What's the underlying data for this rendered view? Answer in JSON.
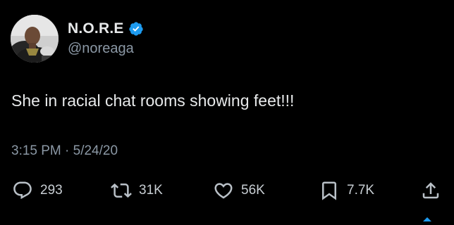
{
  "tweet": {
    "author": {
      "display_name": "N.O.R.E",
      "handle": "@noreaga",
      "verified": true
    },
    "text": "She in racial chat rooms showing feet!!!",
    "time": "3:15 PM",
    "separator": "·",
    "date": "5/24/20",
    "meta_line": "3:15 PM · 5/24/20"
  },
  "actions": {
    "reply": {
      "icon": "reply-icon",
      "count": "293"
    },
    "retweet": {
      "icon": "retweet-icon",
      "count": "31K"
    },
    "like": {
      "icon": "heart-icon",
      "count": "56K"
    },
    "bookmark": {
      "icon": "bookmark-icon",
      "count": "7.7K"
    },
    "share": {
      "icon": "share-icon"
    }
  },
  "colors": {
    "background": "#000000",
    "primary_text": "#e7e9ea",
    "secondary_text": "#8b98a5",
    "verified_badge": "#1d9bf0",
    "action_icon": "#b9c0c7"
  }
}
